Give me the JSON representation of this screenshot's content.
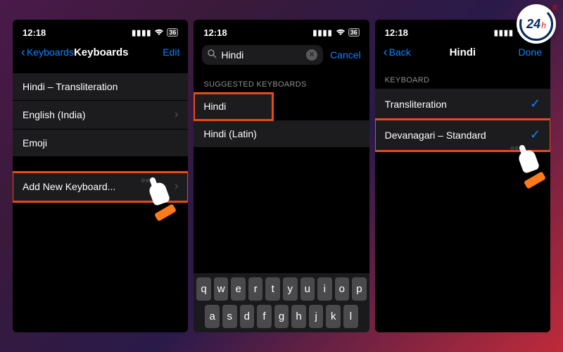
{
  "badge": {
    "number": "24",
    "suffix": "h",
    "reg": "®"
  },
  "status": {
    "time": "12:18",
    "battery": "36"
  },
  "phone1": {
    "nav": {
      "back": "Keyboards",
      "title": "Keyboards",
      "action": "Edit"
    },
    "items": [
      {
        "label": "Hindi – Transliteration"
      },
      {
        "label": "English (India)"
      },
      {
        "label": "Emoji"
      }
    ],
    "add": "Add New Keyboard..."
  },
  "phone2": {
    "search": {
      "value": "Hindi",
      "cancel": "Cancel"
    },
    "section": "Suggested Keyboards",
    "results": [
      {
        "label": "Hindi"
      },
      {
        "label": "Hindi (Latin)"
      }
    ],
    "keys_row1": [
      "q",
      "w",
      "e",
      "r",
      "t",
      "y",
      "u",
      "i",
      "o",
      "p"
    ],
    "keys_row2": [
      "a",
      "s",
      "d",
      "f",
      "g",
      "h",
      "j",
      "k",
      "l"
    ]
  },
  "phone3": {
    "nav": {
      "back": "Back",
      "title": "Hindi",
      "action": "Done"
    },
    "section": "Keyboard",
    "options": [
      {
        "label": "Transliteration",
        "checked": true
      },
      {
        "label": "Devanagari – Standard",
        "checked": true
      }
    ]
  }
}
